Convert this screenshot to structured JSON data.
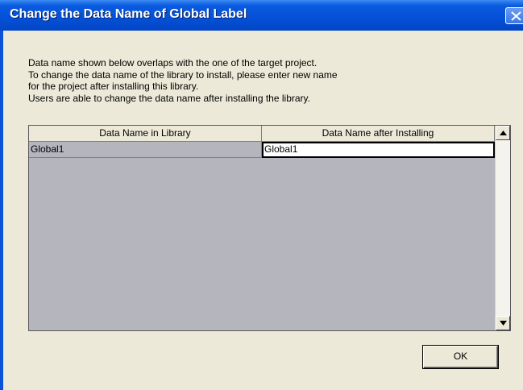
{
  "window": {
    "title": "Change the Data Name of Global Label"
  },
  "message": {
    "lines": [
      "Data name shown below overlaps with the one of the target project.",
      "To change the data name of the library to install, please enter new name",
      "for the project after installing this library.",
      "Users are able to change the data name after installing the library."
    ]
  },
  "grid": {
    "columns": [
      "Data Name in Library",
      "Data Name after Installing"
    ],
    "rows": [
      {
        "library_name": "Global1",
        "installed_name": "Global1"
      }
    ]
  },
  "buttons": {
    "ok_label": "OK"
  },
  "icons": {
    "close": "close-icon",
    "scroll_up": "arrow-up-icon",
    "scroll_down": "arrow-down-icon"
  }
}
